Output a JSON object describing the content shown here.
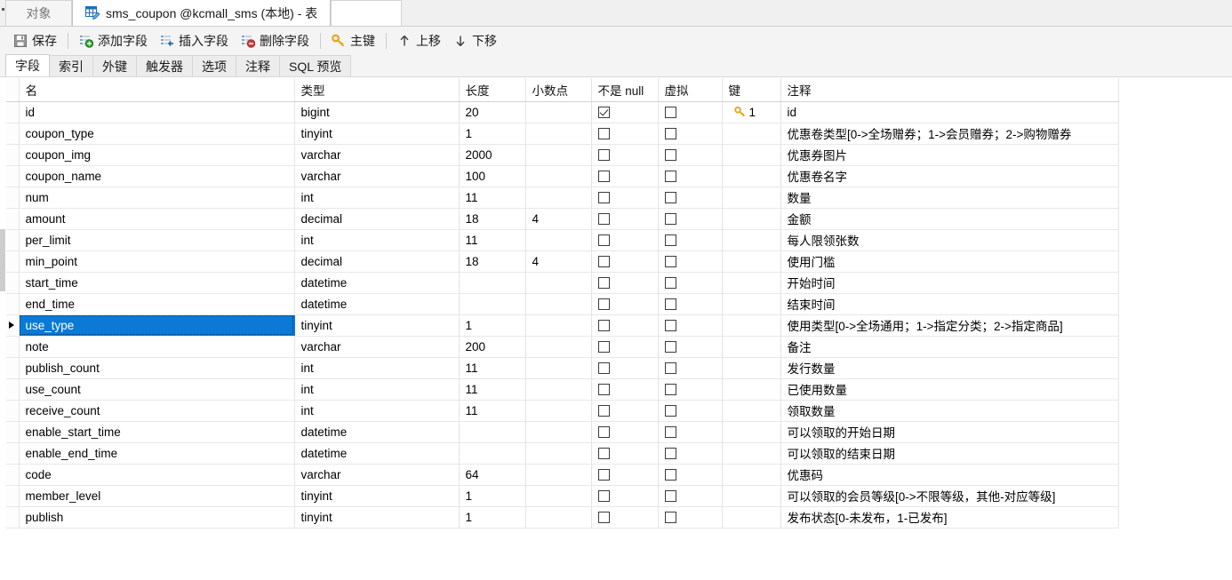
{
  "window": {
    "tabs": [
      {
        "label": "对象",
        "icon": "none",
        "active": false
      },
      {
        "label": "sms_coupon @kcmall_sms (本地) - 表",
        "icon": "table-designer-icon",
        "active": true
      }
    ]
  },
  "toolbar": {
    "buttons": [
      {
        "label": "保存",
        "icon": "save-icon"
      },
      {
        "label": "添加字段",
        "icon": "add-field-icon"
      },
      {
        "label": "插入字段",
        "icon": "insert-field-icon"
      },
      {
        "label": "删除字段",
        "icon": "delete-field-icon"
      },
      {
        "label": "主键",
        "icon": "primary-key-icon"
      },
      {
        "label": "上移",
        "icon": "move-up-icon"
      },
      {
        "label": "下移",
        "icon": "move-down-icon"
      }
    ]
  },
  "subtabs": [
    {
      "label": "字段",
      "active": true
    },
    {
      "label": "索引",
      "active": false
    },
    {
      "label": "外键",
      "active": false
    },
    {
      "label": "触发器",
      "active": false
    },
    {
      "label": "选项",
      "active": false
    },
    {
      "label": "注释",
      "active": false
    },
    {
      "label": "SQL 预览",
      "active": false
    }
  ],
  "grid": {
    "columns": [
      "名",
      "类型",
      "长度",
      "小数点",
      "不是 null",
      "虚拟",
      "键",
      "注释"
    ],
    "selected_row_index": 10,
    "rows": [
      {
        "name": "id",
        "type": "bigint",
        "length": "20",
        "decimals": "",
        "not_null": true,
        "virtual": false,
        "key": "1",
        "comment": "id"
      },
      {
        "name": "coupon_type",
        "type": "tinyint",
        "length": "1",
        "decimals": "",
        "not_null": false,
        "virtual": false,
        "key": "",
        "comment": "优惠卷类型[0->全场赠券；1->会员赠券；2->购物赠券"
      },
      {
        "name": "coupon_img",
        "type": "varchar",
        "length": "2000",
        "decimals": "",
        "not_null": false,
        "virtual": false,
        "key": "",
        "comment": "优惠券图片"
      },
      {
        "name": "coupon_name",
        "type": "varchar",
        "length": "100",
        "decimals": "",
        "not_null": false,
        "virtual": false,
        "key": "",
        "comment": "优惠卷名字"
      },
      {
        "name": "num",
        "type": "int",
        "length": "11",
        "decimals": "",
        "not_null": false,
        "virtual": false,
        "key": "",
        "comment": "数量"
      },
      {
        "name": "amount",
        "type": "decimal",
        "length": "18",
        "decimals": "4",
        "not_null": false,
        "virtual": false,
        "key": "",
        "comment": "金额"
      },
      {
        "name": "per_limit",
        "type": "int",
        "length": "11",
        "decimals": "",
        "not_null": false,
        "virtual": false,
        "key": "",
        "comment": "每人限领张数"
      },
      {
        "name": "min_point",
        "type": "decimal",
        "length": "18",
        "decimals": "4",
        "not_null": false,
        "virtual": false,
        "key": "",
        "comment": "使用门槛"
      },
      {
        "name": "start_time",
        "type": "datetime",
        "length": "",
        "decimals": "",
        "not_null": false,
        "virtual": false,
        "key": "",
        "comment": "开始时间"
      },
      {
        "name": "end_time",
        "type": "datetime",
        "length": "",
        "decimals": "",
        "not_null": false,
        "virtual": false,
        "key": "",
        "comment": "结束时间"
      },
      {
        "name": "use_type",
        "type": "tinyint",
        "length": "1",
        "decimals": "",
        "not_null": false,
        "virtual": false,
        "key": "",
        "comment": "使用类型[0->全场通用；1->指定分类；2->指定商品]"
      },
      {
        "name": "note",
        "type": "varchar",
        "length": "200",
        "decimals": "",
        "not_null": false,
        "virtual": false,
        "key": "",
        "comment": "备注"
      },
      {
        "name": "publish_count",
        "type": "int",
        "length": "11",
        "decimals": "",
        "not_null": false,
        "virtual": false,
        "key": "",
        "comment": "发行数量"
      },
      {
        "name": "use_count",
        "type": "int",
        "length": "11",
        "decimals": "",
        "not_null": false,
        "virtual": false,
        "key": "",
        "comment": "已使用数量"
      },
      {
        "name": "receive_count",
        "type": "int",
        "length": "11",
        "decimals": "",
        "not_null": false,
        "virtual": false,
        "key": "",
        "comment": "领取数量"
      },
      {
        "name": "enable_start_time",
        "type": "datetime",
        "length": "",
        "decimals": "",
        "not_null": false,
        "virtual": false,
        "key": "",
        "comment": "可以领取的开始日期"
      },
      {
        "name": "enable_end_time",
        "type": "datetime",
        "length": "",
        "decimals": "",
        "not_null": false,
        "virtual": false,
        "key": "",
        "comment": "可以领取的结束日期"
      },
      {
        "name": "code",
        "type": "varchar",
        "length": "64",
        "decimals": "",
        "not_null": false,
        "virtual": false,
        "key": "",
        "comment": "优惠码"
      },
      {
        "name": "member_level",
        "type": "tinyint",
        "length": "1",
        "decimals": "",
        "not_null": false,
        "virtual": false,
        "key": "",
        "comment": "可以领取的会员等级[0->不限等级，其他-对应等级]"
      },
      {
        "name": "publish",
        "type": "tinyint",
        "length": "1",
        "decimals": "",
        "not_null": false,
        "virtual": false,
        "key": "",
        "comment": "发布状态[0-未发布，1-已发布]"
      }
    ]
  },
  "colors": {
    "selection": "#0a7ad6",
    "key_gold": "#e8a317",
    "add_green": "#2aa02a",
    "delete_red": "#d03c3c"
  }
}
